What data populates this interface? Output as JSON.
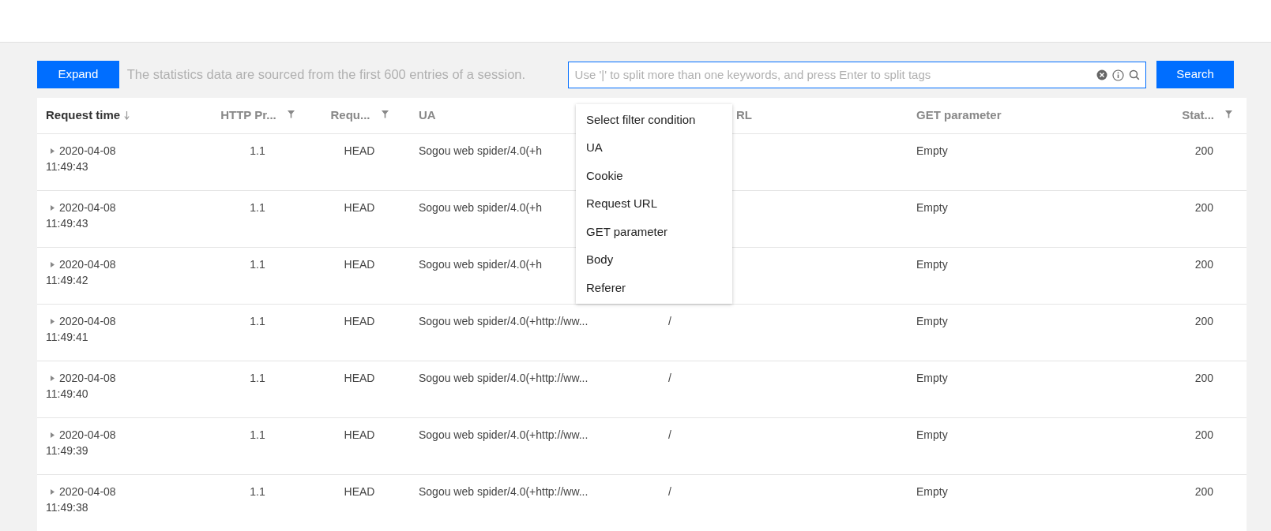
{
  "toolbar": {
    "expand_button": "Expand",
    "hint": "The statistics data are sourced from the first 600 entries of a session.",
    "search": {
      "placeholder": "Use '|' to split more than one keywords, and press Enter to split tags"
    },
    "search_button": "Search"
  },
  "table": {
    "columns": [
      {
        "label": "Request time",
        "sort": true,
        "filter": false
      },
      {
        "label": "HTTP Pr...",
        "sort": false,
        "filter": true
      },
      {
        "label": "Requ...",
        "sort": false,
        "filter": true
      },
      {
        "label": "UA",
        "sort": false,
        "filter": false
      },
      {
        "label": "RL",
        "sort": false,
        "filter": false
      },
      {
        "label": "GET parameter",
        "sort": false,
        "filter": false
      },
      {
        "label": "Stat...",
        "sort": false,
        "filter": true
      }
    ],
    "rows": [
      {
        "date": "2020-04-08",
        "time": "11:49:43",
        "http": "1.1",
        "method": "HEAD",
        "ua": "Sogou web spider/4.0(+h",
        "url": "",
        "get": "Empty",
        "status": "200"
      },
      {
        "date": "2020-04-08",
        "time": "11:49:43",
        "http": "1.1",
        "method": "HEAD",
        "ua": "Sogou web spider/4.0(+h",
        "url": "",
        "get": "Empty",
        "status": "200"
      },
      {
        "date": "2020-04-08",
        "time": "11:49:42",
        "http": "1.1",
        "method": "HEAD",
        "ua": "Sogou web spider/4.0(+h",
        "url": "",
        "get": "Empty",
        "status": "200"
      },
      {
        "date": "2020-04-08",
        "time": "11:49:41",
        "http": "1.1",
        "method": "HEAD",
        "ua": "Sogou web spider/4.0(+http://ww...",
        "url": "/",
        "get": "Empty",
        "status": "200"
      },
      {
        "date": "2020-04-08",
        "time": "11:49:40",
        "http": "1.1",
        "method": "HEAD",
        "ua": "Sogou web spider/4.0(+http://ww...",
        "url": "/",
        "get": "Empty",
        "status": "200"
      },
      {
        "date": "2020-04-08",
        "time": "11:49:39",
        "http": "1.1",
        "method": "HEAD",
        "ua": "Sogou web spider/4.0(+http://ww...",
        "url": "/",
        "get": "Empty",
        "status": "200"
      },
      {
        "date": "2020-04-08",
        "time": "11:49:38",
        "http": "1.1",
        "method": "HEAD",
        "ua": "Sogou web spider/4.0(+http://ww...",
        "url": "/",
        "get": "Empty",
        "status": "200"
      }
    ]
  },
  "filter_menu": {
    "items": [
      "Select filter condition",
      "UA",
      "Cookie",
      "Request URL",
      "GET parameter",
      "Body",
      "Referer"
    ]
  }
}
